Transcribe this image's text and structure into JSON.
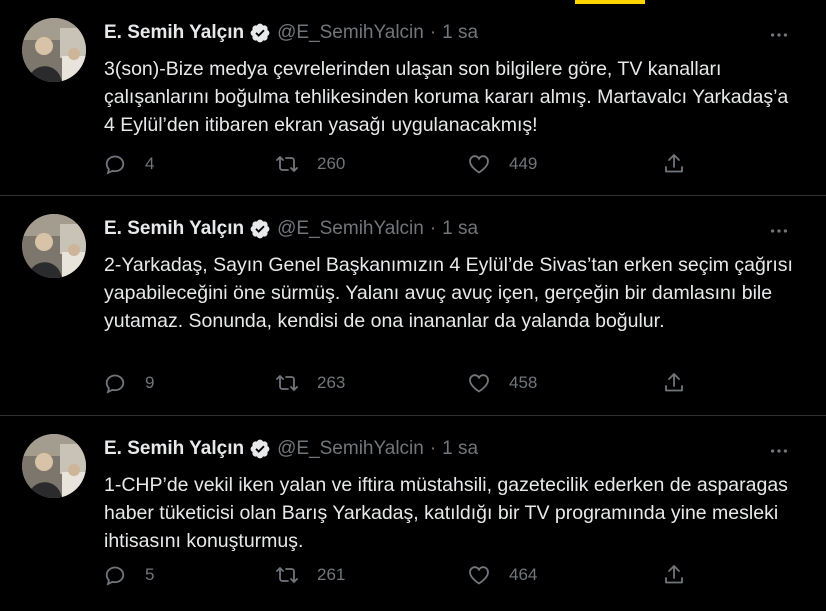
{
  "colors": {
    "background": "#000000",
    "text": "#e7e9ea",
    "muted": "#71767b",
    "divider": "#2f3336",
    "verified": "#e7e9ea"
  },
  "icons": {
    "reply": "reply-icon",
    "retweet": "retweet-icon",
    "like": "heart-icon",
    "share": "share-icon",
    "more": "more-dots-icon",
    "verified": "verified-badge-icon"
  },
  "tweets": [
    {
      "name": "E. Semih Yalçın",
      "handle": "@E_SemihYalcin",
      "separator": "·",
      "time": "1 sa",
      "text": "3(son)-Bize medya çevrelerinden ulaşan son bilgilere göre, TV kanalları çalışanlarını boğulma tehlikesinden koruma kararı almış. Martavalcı Yarkadaş’a 4 Eylül’den itibaren ekran yasağı uygulanacakmış!",
      "replies": "4",
      "retweets": "260",
      "likes": "449"
    },
    {
      "name": "E. Semih Yalçın",
      "handle": "@E_SemihYalcin",
      "separator": "·",
      "time": "1 sa",
      "text": "2-Yarkadaş, Sayın Genel Başkanımızın 4 Eylül’de Sivas’tan erken seçim çağrısı yapabileceğini öne sürmüş. Yalanı avuç avuç içen, gerçeğin bir damlasını bile yutamaz. Sonunda, kendisi de ona inananlar da yalanda boğulur.",
      "replies": "9",
      "retweets": "263",
      "likes": "458"
    },
    {
      "name": "E. Semih Yalçın",
      "handle": "@E_SemihYalcin",
      "separator": "·",
      "time": "1 sa",
      "text": "1-CHP’de vekil iken yalan ve iftira müstahsili, gazetecilik ederken de asparagas haber tüketicisi olan Barış Yarkadaş, katıldığı bir TV programında yine mesleki ihtisasını konuşturmuş.",
      "replies": "5",
      "retweets": "261",
      "likes": "464"
    }
  ]
}
